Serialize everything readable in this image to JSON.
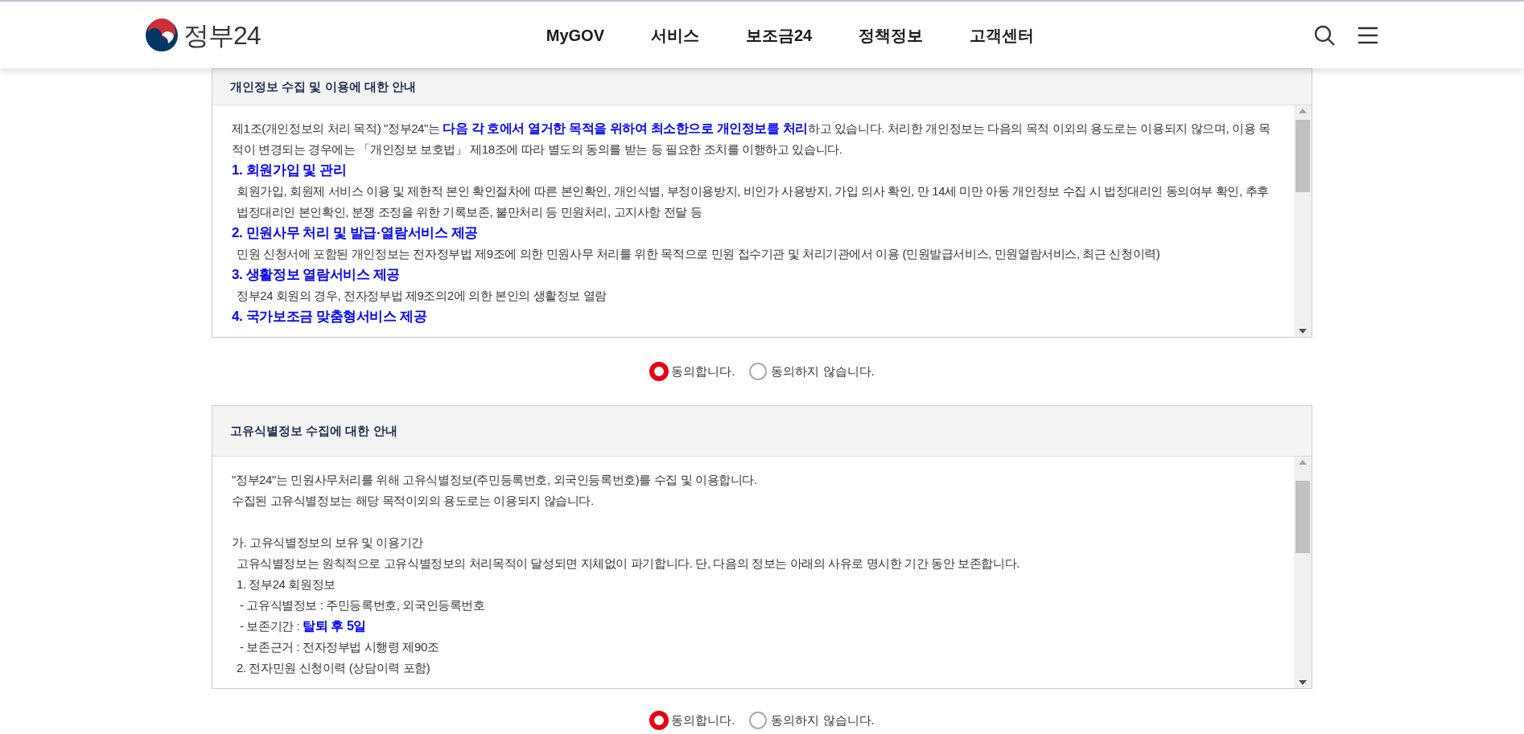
{
  "header": {
    "logo_text": "정부24",
    "nav": [
      {
        "label": "MyGOV"
      },
      {
        "label": "서비스"
      },
      {
        "label": "보조금24"
      },
      {
        "label": "정책정보"
      },
      {
        "label": "고객센터"
      }
    ]
  },
  "sections": [
    {
      "title": "개인정보 수집 및 이용에 대한 안내",
      "paragraphs": [
        {
          "kind": "text",
          "text": "제1조(개인정보의 처리 목적) \"정부24\"는 **다음 각 호에서 열거한 목적을 위하여 최소한으로 개인정보를 처리**하고 있습니다. 처리한 개인정보는 다음의 목적 이외의 용도로는 이용되지 않으며, 이용 목적이 변경되는 경우에는 「개인정보 보호법」 제18조에 따라 별도의 동의를 받는 등 필요한 조치를 이행하고 있습니다."
        },
        {
          "kind": "heading",
          "text": "1. 회원가입 및 관리"
        },
        {
          "kind": "item",
          "text": "회원가입, 회원제 서비스 이용 및 제한적 본인 확인절차에 따른 본인확인, 개인식별, 부정이용방지, 비인가 사용방지, 가입 의사 확인, 만 14세 미만 아동 개인정보 수집 시 법정대리인 동의여부 확인, 추후 법정대리인 본인확인, 분쟁 조정을 위한 기록보존, 불만처리 등 민원처리, 고지사항 전달 등"
        },
        {
          "kind": "heading",
          "text": "2. 민원사무 처리 및 발급·열람서비스 제공"
        },
        {
          "kind": "item",
          "text": "민원 신청서에 포함된 개인정보는 전자정부법 제9조에 의한 민원사무 처리를 위한 목적으로 민원 접수기관 및 처리기관에서 이용 (민원발급서비스, 민원열람서비스, 최근 신청이력)"
        },
        {
          "kind": "heading",
          "text": "3. 생활정보 열람서비스 제공"
        },
        {
          "kind": "item",
          "text": "정부24 회원의 경우, 전자정부법 제9조의2에 의한 본인의 생활정보 열람"
        },
        {
          "kind": "heading",
          "text": "4. 국가보조금 맞춤형서비스 제공"
        }
      ],
      "options": [
        {
          "label": "동의합니다.",
          "selected": true
        },
        {
          "label": "동의하지 않습니다.",
          "selected": false
        }
      ]
    },
    {
      "title": "고유식별정보 수집에 대한 안내",
      "paragraphs": [
        {
          "kind": "text",
          "text": "\"정부24\"는 민원사무처리를 위해 고유식별정보(주민등록번호, 외국인등록번호)를 수집 및 이용합니다."
        },
        {
          "kind": "text",
          "text": "수집된 고유식별정보는 해당 목적이외의 용도로는 이용되지 않습니다."
        },
        {
          "kind": "spaced",
          "text": "가. 고유식별정보의 보유 및 이용기간"
        },
        {
          "kind": "item",
          "text": "고유식별정보는 원칙적으로 고유식별정보의 처리목적이 달성되면 지체없이 파기합니다. 단, 다음의 정보는 아래의 사유로 명시한 기간 동안 보존합니다."
        },
        {
          "kind": "item",
          "text": "1. 정부24 회원정보"
        },
        {
          "kind": "subitem",
          "text": "- 고유식별정보 : 주민등록번호, 외국인등록번호"
        },
        {
          "kind": "subitem",
          "text": "- 보존기간 : **탈퇴 후 5일**"
        },
        {
          "kind": "subitem",
          "text": "- 보존근거 : 전자정부법 시행령 제90조"
        },
        {
          "kind": "item",
          "text": "2. 전자민원 신청이력 (상담이력 포함)"
        }
      ],
      "options": [
        {
          "label": "동의합니다.",
          "selected": true
        },
        {
          "label": "동의하지 않습니다.",
          "selected": false
        }
      ]
    }
  ]
}
